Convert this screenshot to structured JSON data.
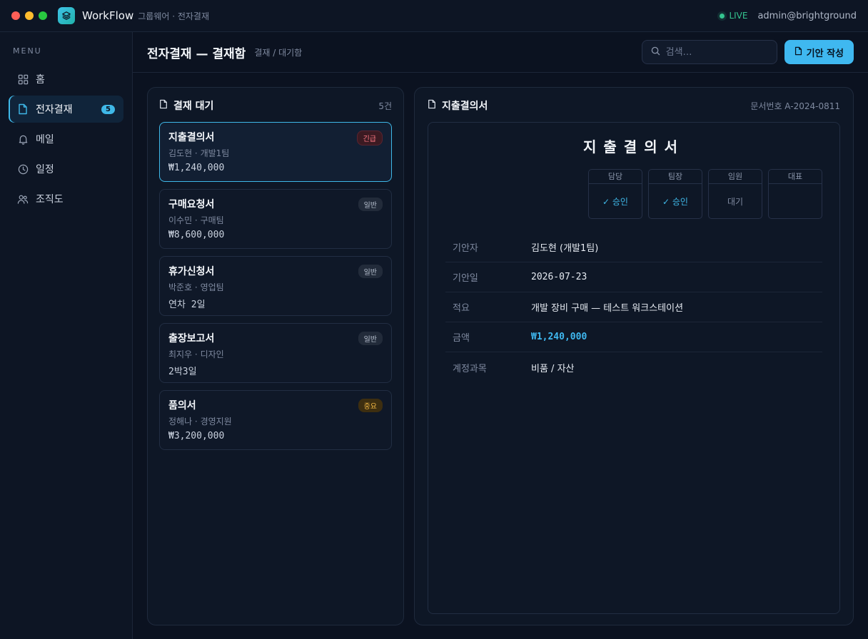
{
  "titlebar": {
    "app_name": "WorkFlow",
    "app_sub": "그룹웨어 · 전자결재",
    "live_label": "LIVE",
    "user": "admin@brightground"
  },
  "sidebar": {
    "menu_label": "MENU",
    "items": [
      {
        "label": "홈",
        "icon": "grid-icon"
      },
      {
        "label": "전자결재",
        "icon": "document-icon",
        "badge": "5"
      },
      {
        "label": "메일",
        "icon": "bell-icon"
      },
      {
        "label": "일정",
        "icon": "clock-icon"
      },
      {
        "label": "조직도",
        "icon": "users-icon"
      }
    ]
  },
  "header": {
    "title": "전자결재 — 결재함",
    "breadcrumb": "결재 / 대기함",
    "search_placeholder": "검색…",
    "new_button": "기안 작성"
  },
  "list_panel": {
    "title": "결재 대기",
    "count": "5건",
    "docs": [
      {
        "title": "지출결의서",
        "sub": "김도현 · 개발1팀",
        "detail": "₩1,240,000",
        "tag": "긴급"
      },
      {
        "title": "구매요청서",
        "sub": "이수민 · 구매팀",
        "detail": "₩8,600,000",
        "tag": "일반"
      },
      {
        "title": "휴가신청서",
        "sub": "박준호 · 영업팀",
        "detail": "연차 2일",
        "tag": "일반"
      },
      {
        "title": "출장보고서",
        "sub": "최지우 · 디자인",
        "detail": "2박3일",
        "tag": "일반"
      },
      {
        "title": "품의서",
        "sub": "정해나 · 경영지원",
        "detail": "₩3,200,000",
        "tag": "중요"
      }
    ]
  },
  "detail_panel": {
    "title": "지출결의서",
    "doc_number": "문서번호 A-2024-0811",
    "heading": "지출결의서",
    "approvals": [
      {
        "role": "담당",
        "status": "✓ 승인"
      },
      {
        "role": "팀장",
        "status": "✓ 승인"
      },
      {
        "role": "임원",
        "status": "대기"
      },
      {
        "role": "대표",
        "status": ""
      }
    ],
    "fields": [
      {
        "label": "기안자",
        "value": "김도현 (개발1팀)"
      },
      {
        "label": "기안일",
        "value": "2026-07-23"
      },
      {
        "label": "적요",
        "value": "개발 장비 구매 — 테스트 워크스테이션"
      },
      {
        "label": "금액",
        "value": "₩1,240,000"
      },
      {
        "label": "계정과목",
        "value": "비품 / 자산"
      }
    ]
  },
  "colors": {
    "accent": "#3fb8f0",
    "live": "#34c38f",
    "urgent": "#ff7a85",
    "important": "#f5b945"
  }
}
